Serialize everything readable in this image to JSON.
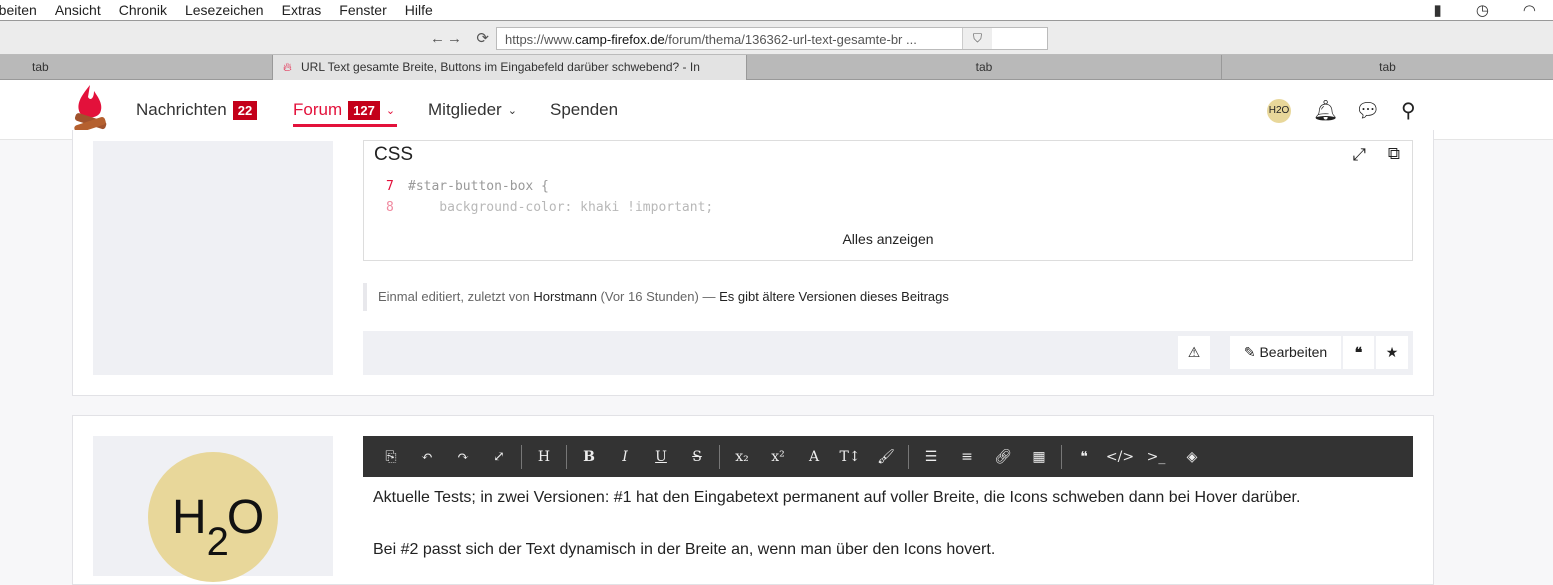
{
  "menubar": {
    "items": [
      "rbeiten",
      "Ansicht",
      "Chronik",
      "Lesezeichen",
      "Extras",
      "Fenster",
      "Hilfe"
    ]
  },
  "toolbar": {
    "url_prefix": "https://www.",
    "url_domain": "camp-firefox.de",
    "url_path": "/forum/thema/136362-url-text-gesamte-br ..."
  },
  "tabs": [
    {
      "title": "tab"
    },
    {
      "title": "URL Text gesamte Breite, Buttons im Eingabefeld darüber schwebend? - In"
    },
    {
      "title": "tab"
    },
    {
      "title": "tab"
    }
  ],
  "nav": {
    "nachrichten": "Nachrichten",
    "nachrichten_count": "22",
    "forum": "Forum",
    "forum_count": "127",
    "mitglieder": "Mitglieder",
    "spenden": "Spenden",
    "avatar_text": "H2O"
  },
  "post": {
    "code_title": "CSS",
    "code_lines": [
      {
        "n": "7",
        "text": "#star-button-box {"
      },
      {
        "n": "8",
        "text": "    background-color: khaki !important;"
      }
    ],
    "show_all": "Alles anzeigen",
    "edit_note_prefix": "Einmal editiert, zuletzt von ",
    "edit_author": "Horstmann",
    "edit_time": " (Vor 16 Stunden) — ",
    "edit_versions": "Es gibt ältere Versionen dieses Beitrags",
    "edit_button": "Bearbeiten"
  },
  "editor": {
    "paragraphs": [
      "Aktuelle Tests; in zwei Versionen: #1 hat den Eingabetext permanent auf voller Breite, die Icons schweben dann bei Hover darüber.",
      "Bei #2 passt sich der Text dynamisch in der Breite an, wenn man über den Icons hovert."
    ],
    "avatar": "H2O"
  },
  "colors": {
    "accent": "#e3113b",
    "badge": "#c4001a",
    "editor_bg": "#333333",
    "avatar": "#e8d79a"
  }
}
